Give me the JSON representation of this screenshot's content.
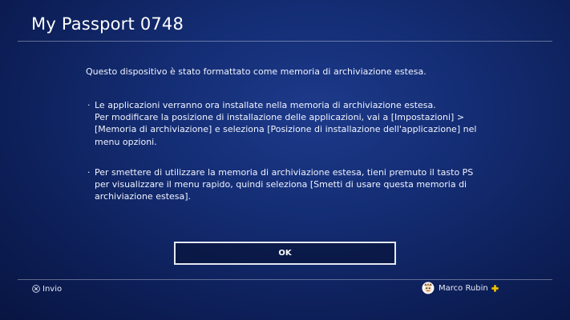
{
  "window": {
    "title": "My Passport 0748"
  },
  "dialog": {
    "intro": "Questo dispositivo è stato formattato come memoria di archiviazione estesa.",
    "bullet_glyph": "·",
    "bullets": [
      {
        "line1": "Le applicazioni verranno ora installate nella memoria di archiviazione estesa.",
        "line2": "Per modificare la posizione di installazione delle applicazioni, vai a [Impostazioni] > [Memoria di archiviazione] e seleziona [Posizione di installazione dell'applicazione] nel menu opzioni."
      },
      {
        "line1": "Per smettere di utilizzare la memoria di archiviazione estesa, tieni premuto il tasto PS per visualizzare il menu rapido, quindi seleziona [Smetti di usare questa memoria di archiviazione estesa]."
      }
    ],
    "ok_label": "OK"
  },
  "footer": {
    "enter_icon": "cross-button-icon",
    "enter_label": "Invio",
    "user_name": "Marco Rubin",
    "avatar_icon": "user-avatar",
    "plus_icon": "ps-plus-icon"
  },
  "colors": {
    "background": "#142d74",
    "plus_gold": "#f2c300"
  }
}
